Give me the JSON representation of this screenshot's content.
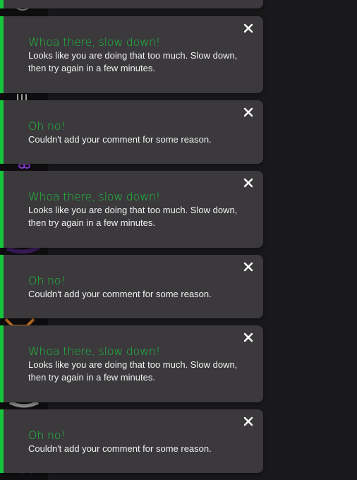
{
  "toasts": [
    {
      "title": "",
      "message": ""
    },
    {
      "title": "Whoa there, slow down!",
      "message": "Looks like you are doing that too much. Slow down, then try again in a few minutes."
    },
    {
      "title": "Oh no!",
      "message": "Couldn't add your comment for some reason."
    },
    {
      "title": "Whoa there, slow down!",
      "message": "Looks like you are doing that too much. Slow down, then try again in a few minutes."
    },
    {
      "title": "Oh no!",
      "message": "Couldn't add your comment for some reason."
    },
    {
      "title": "Whoa there, slow down!",
      "message": "Looks like you are doing that too much. Slow down, then try again in a few minutes."
    },
    {
      "title": "Oh no!",
      "message": "Couldn't add your comment for some reason."
    }
  ],
  "close_icon": "close-icon",
  "colors": {
    "accent": "#15c63c",
    "title": "#1fbf3f",
    "toast_bg": "#3b393c",
    "page_bg": "#19181a"
  }
}
